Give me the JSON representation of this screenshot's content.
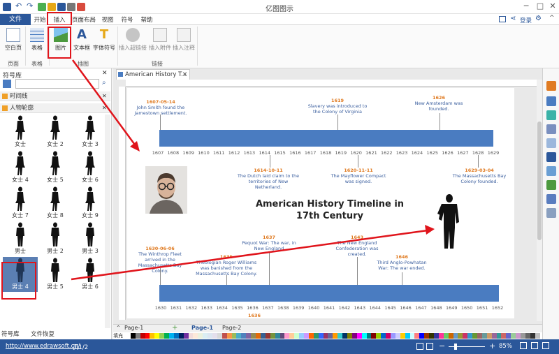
{
  "app": {
    "title": "亿图图示"
  },
  "menu": {
    "file": "文件",
    "tabs": [
      "开始",
      "插入",
      "页面布局",
      "视图",
      "符号",
      "帮助"
    ],
    "login": "登录"
  },
  "ribbon": {
    "groups": {
      "page": "页面",
      "table": "表格",
      "illustration": "插图",
      "link": "链接"
    },
    "buttons": {
      "blank_page": "空白页",
      "table": "表格",
      "image": "图片",
      "textbox": "文本框",
      "font_symbol": "字体符号",
      "hyperlink": "插入超链接",
      "attachment": "插入附件",
      "note": "插入注释"
    }
  },
  "library": {
    "title": "符号库",
    "categories": [
      "时间线",
      "人物轮廓"
    ],
    "shapes": [
      "女士",
      "女士 2",
      "女士 3",
      "女士 4",
      "女士 5",
      "女士 6",
      "女士 7",
      "女士 8",
      "女士 9",
      "男士",
      "男士 2",
      "男士 3",
      "男士 4",
      "男士 5",
      "男士 6"
    ],
    "bottom_tabs": [
      "符号库",
      "文件恢复"
    ]
  },
  "document": {
    "tab": "American History T...",
    "title": "American History Timeline in 17th Century",
    "top_ticks": [
      "1607",
      "1608",
      "1609",
      "1610",
      "1611",
      "1612",
      "1613",
      "1614",
      "1615",
      "1616",
      "1617",
      "1618",
      "1619",
      "1620",
      "1621",
      "1622",
      "1623",
      "1624",
      "1625",
      "1626",
      "1627",
      "1628",
      "1629"
    ],
    "bottom_ticks": [
      "1630",
      "1631",
      "1632",
      "1633",
      "1634",
      "1635",
      "1636",
      "1637",
      "1638",
      "1639",
      "1640",
      "1641",
      "1642",
      "1643",
      "1644",
      "1645",
      "1646",
      "1647",
      "1648",
      "1649",
      "1650",
      "1651",
      "1652"
    ],
    "top_events_above": [
      {
        "date": "1607-05-14",
        "text": "John Smith found the Jamestown settlement."
      },
      {
        "date": "1619",
        "text": "Slavery was introduced to the Colony of Virginia"
      },
      {
        "date": "1626",
        "text": "New Amsterdam was founded."
      }
    ],
    "top_events_below": [
      {
        "date": "1614-10-11",
        "text": "The Dutch laid claim to the territories of New Netherland."
      },
      {
        "date": "1620-11-11",
        "text": "The Mayflower Compact was signed."
      },
      {
        "date": "1629-03-04",
        "text": "The Massachusetts Bay Colony founded."
      }
    ],
    "bottom_events_above": [
      {
        "date": "1630-06-06",
        "text": "The Winthrop Fleet arrived in the Massachusetts Bay Colony."
      },
      {
        "date": "1635",
        "text": "Theologian Roger Williams was banished from the Massachusetts Bay Colony."
      },
      {
        "date": "1637",
        "text": "Pequot War: The war, in New England"
      },
      {
        "date": "1643",
        "text": "The New England Confederation was created."
      },
      {
        "date": "1646",
        "text": "Third Anglo-Powhatan War: The war ended."
      }
    ],
    "partial_date": "1636"
  },
  "pages": {
    "items": [
      "Page-1",
      "Page-1",
      "Page-2"
    ],
    "fill_label": "填充"
  },
  "status": {
    "url": "http://www.edrawsoft.cn/",
    "page_info": "页1/2",
    "zoom": "85%"
  },
  "colors": {
    "accent": "#2b579a",
    "timeline": "#4a7cc1",
    "highlight": "#e0141b",
    "date": "#e07b22"
  }
}
